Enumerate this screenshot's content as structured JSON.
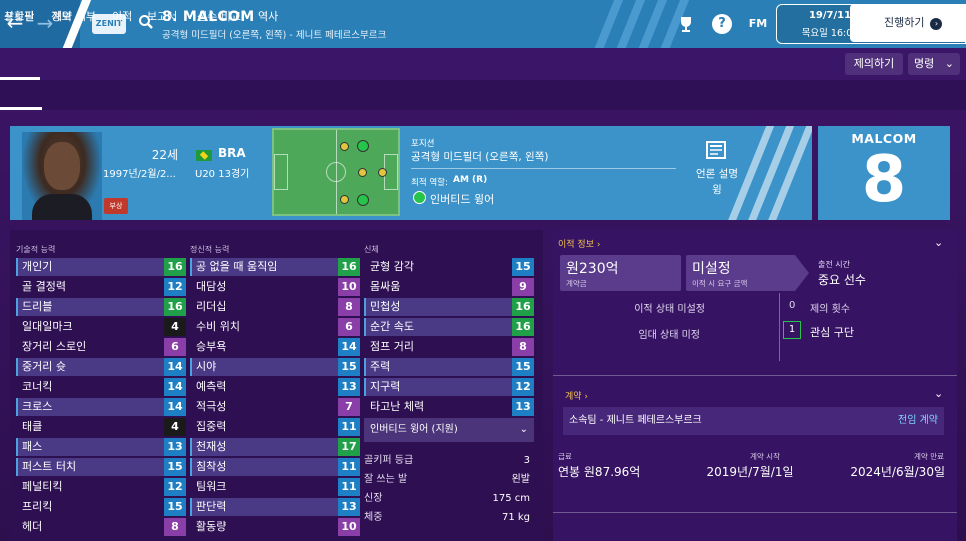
{
  "topbar": {
    "back_icon": "arrow-left-icon",
    "forward_icon": "arrow-right-icon",
    "club_crest": "ZENIT",
    "title": "8. MALCOM",
    "subtitle": "공격형 미드필더 (오른쪽, 왼쪽) - 제니트 페테르스부르크",
    "icons": [
      "trophy-icon",
      "help-icon",
      "fm-icon"
    ],
    "fm_label": "FM",
    "help_label": "?",
    "date": "19/7/11",
    "day_time": "목요일 16:00",
    "continue_label": "진행하기"
  },
  "tabs_main": [
    "상황판",
    "계약 세부",
    "이적",
    "보고서",
    "선수 비교",
    "역사"
  ],
  "tabs_main_active": 0,
  "right_buttons": {
    "offer": "제의하기",
    "command": "명령"
  },
  "tabs_sub": [
    "프로필",
    "정보"
  ],
  "profile": {
    "age": "22세",
    "dob": "1997년/2월/2...",
    "nation": "BRA",
    "caps": "U20 13경기",
    "injury": "부상",
    "position_label": "포지션",
    "position": "공격형 미드필더 (오른쪽, 왼쪽)",
    "best_role_label": "최적 역할:",
    "best_role": "AM (R)",
    "role_name": "인버티드 윙어",
    "media_label": "언론 설명",
    "media_value": "윙",
    "kit_name": "MALCOM",
    "kit_number": "8"
  },
  "attributes": {
    "technical_header": "기술적 능력",
    "mental_header": "정신적 능력",
    "physical_header": "신체",
    "technical": [
      {
        "name": "개인기",
        "value": "16",
        "hl": true
      },
      {
        "name": "골 결정력",
        "value": "12",
        "hl": false
      },
      {
        "name": "드리블",
        "value": "16",
        "hl": true
      },
      {
        "name": "일대일마크",
        "value": "4",
        "hl": false
      },
      {
        "name": "장거리 스로인",
        "value": "6",
        "hl": false
      },
      {
        "name": "중거리 슛",
        "value": "14",
        "hl": true
      },
      {
        "name": "코너킥",
        "value": "14",
        "hl": false
      },
      {
        "name": "크로스",
        "value": "14",
        "hl": true
      },
      {
        "name": "태클",
        "value": "4",
        "hl": false
      },
      {
        "name": "패스",
        "value": "13",
        "hl": true
      },
      {
        "name": "퍼스트 터치",
        "value": "15",
        "hl": true
      },
      {
        "name": "페널티킥",
        "value": "12",
        "hl": false
      },
      {
        "name": "프리킥",
        "value": "15",
        "hl": false
      },
      {
        "name": "헤더",
        "value": "8",
        "hl": false
      }
    ],
    "mental": [
      {
        "name": "공 없을 때 움직임",
        "value": "16",
        "hl": true
      },
      {
        "name": "대담성",
        "value": "10",
        "hl": false
      },
      {
        "name": "리더십",
        "value": "8",
        "hl": false
      },
      {
        "name": "수비 위치",
        "value": "6",
        "hl": false
      },
      {
        "name": "승부욕",
        "value": "14",
        "hl": false
      },
      {
        "name": "시야",
        "value": "15",
        "hl": true
      },
      {
        "name": "예측력",
        "value": "13",
        "hl": false
      },
      {
        "name": "적극성",
        "value": "7",
        "hl": false
      },
      {
        "name": "집중력",
        "value": "11",
        "hl": false
      },
      {
        "name": "천재성",
        "value": "17",
        "hl": true
      },
      {
        "name": "침착성",
        "value": "11",
        "hl": true
      },
      {
        "name": "팀워크",
        "value": "11",
        "hl": false
      },
      {
        "name": "판단력",
        "value": "13",
        "hl": true
      },
      {
        "name": "활동량",
        "value": "10",
        "hl": false
      }
    ],
    "physical": [
      {
        "name": "균형 감각",
        "value": "15",
        "hl": false
      },
      {
        "name": "몸싸움",
        "value": "9",
        "hl": false
      },
      {
        "name": "민첩성",
        "value": "16",
        "hl": true
      },
      {
        "name": "순간 속도",
        "value": "16",
        "hl": true
      },
      {
        "name": "점프 거리",
        "value": "8",
        "hl": false
      },
      {
        "name": "주력",
        "value": "15",
        "hl": true
      },
      {
        "name": "지구력",
        "value": "12",
        "hl": true
      },
      {
        "name": "타고난 체력",
        "value": "13",
        "hl": false
      }
    ],
    "role_select": "인버티드 윙어 (지원)",
    "info": [
      {
        "label": "골키퍼 등급",
        "value": "3"
      },
      {
        "label": "잘 쓰는 발",
        "value": "왼발"
      },
      {
        "label": "신장",
        "value": "175 cm"
      },
      {
        "label": "체중",
        "value": "71 kg"
      }
    ]
  },
  "transfer": {
    "title": "이적 정보",
    "fee": "원230억",
    "fee_label": "계약금",
    "status": "미설정",
    "status_label": "이적 시 요구 금액",
    "release_label": "출전 시간",
    "release_value": "중요 선수",
    "transfer_status": "이적 상태 미설정",
    "loan_status": "임대 상태 미정",
    "offers_count": "0",
    "offers_label": "제의 횟수",
    "interest_count": "1",
    "interest_label": "관심 구단"
  },
  "contract": {
    "title": "계약",
    "club": "소속팀 - 제니트 페테르스부르크",
    "transfer_link": "전임 계약",
    "wage_label": "급료",
    "wage": "연봉 원87.96억",
    "start_label": "계약 시작",
    "start": "2019년/7월/1일",
    "end_label": "계약 만료",
    "end": "2024년/6월/30일"
  }
}
